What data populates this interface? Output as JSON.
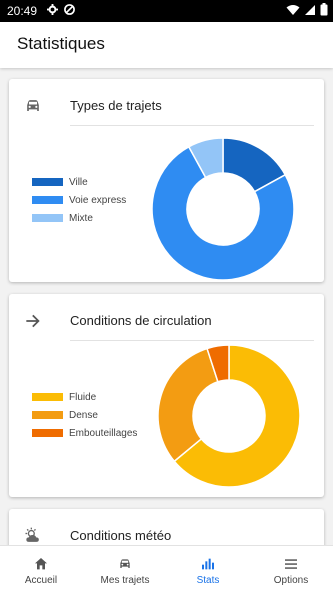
{
  "status": {
    "time": "20:49"
  },
  "appbar": {
    "title": "Statistiques"
  },
  "cards": [
    {
      "title": "Types de trajets",
      "icon": "car-icon",
      "chart_data": {
        "type": "pie",
        "categories": [
          "Ville",
          "Voie express",
          "Mixte"
        ],
        "values": [
          17,
          75,
          8
        ],
        "colors": [
          "#1565c0",
          "#2f8cf2",
          "#93c5f7"
        ]
      }
    },
    {
      "title": "Conditions de circulation",
      "icon": "arrow-right-icon",
      "chart_data": {
        "type": "pie",
        "categories": [
          "Fluide",
          "Dense",
          "Embouteillages"
        ],
        "values": [
          64,
          31,
          5
        ],
        "colors": [
          "#fbbc05",
          "#f39c12",
          "#ef6c00"
        ]
      }
    },
    {
      "title": "Conditions météo",
      "icon": "weather-icon"
    }
  ],
  "nav": [
    {
      "label": "Accueil",
      "icon": "home-icon"
    },
    {
      "label": "Mes trajets",
      "icon": "car-icon"
    },
    {
      "label": "Stats",
      "icon": "stats-icon",
      "active": true
    },
    {
      "label": "Options",
      "icon": "menu-icon"
    }
  ],
  "colors": {
    "accent": "#1a73e8"
  }
}
